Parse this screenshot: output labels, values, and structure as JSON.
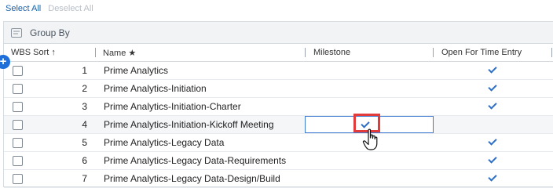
{
  "toolbar": {
    "select_all": "Select All",
    "deselect_all": "Deselect All"
  },
  "group_by": {
    "label": "Group By"
  },
  "columns": {
    "wbs_sort": "WBS Sort ↑",
    "name": "Name ★",
    "milestone": "Milestone",
    "open_for_time_entry": "Open For Time Entry"
  },
  "rows": [
    {
      "num": "1",
      "name": "Prime Analytics",
      "milestone": false,
      "open": true
    },
    {
      "num": "2",
      "name": "Prime Analytics-Initiation",
      "milestone": false,
      "open": true
    },
    {
      "num": "3",
      "name": "Prime Analytics-Initiation-Charter",
      "milestone": false,
      "open": true
    },
    {
      "num": "4",
      "name": "Prime Analytics-Initiation-Kickoff Meeting",
      "milestone": true,
      "open": false
    },
    {
      "num": "5",
      "name": "Prime Analytics-Legacy Data",
      "milestone": false,
      "open": true
    },
    {
      "num": "6",
      "name": "Prime Analytics-Legacy Data-Requirements",
      "milestone": false,
      "open": true
    },
    {
      "num": "7",
      "name": "Prime Analytics-Legacy Data-Design/Build",
      "milestone": false,
      "open": true
    }
  ],
  "colors": {
    "accent": "#1e6fd9",
    "check": "#2e6fc4",
    "highlight": "#e23b3b"
  },
  "icons": {
    "add": "plus-circle-icon",
    "group_by": "group-by-icon",
    "cursor": "hand-pointer-icon"
  }
}
